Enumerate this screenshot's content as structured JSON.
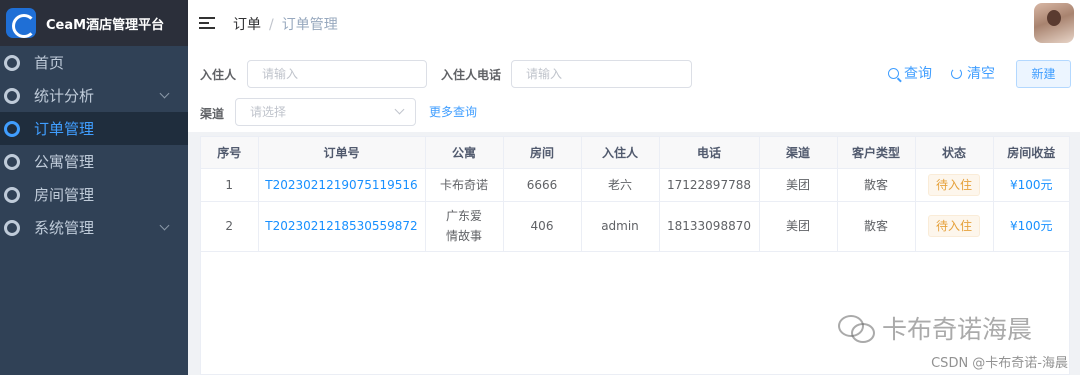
{
  "app": {
    "title": "CeaM酒店管理平台"
  },
  "sidebar": {
    "items": [
      {
        "label": "首页"
      },
      {
        "label": "统计分析"
      },
      {
        "label": "订单管理"
      },
      {
        "label": "公寓管理"
      },
      {
        "label": "房间管理"
      },
      {
        "label": "系统管理"
      }
    ],
    "active_index": 2
  },
  "header": {
    "breadcrumb": [
      "订单",
      "/",
      "订单管理"
    ]
  },
  "filters": {
    "guest_label": "入住人",
    "guest_placeholder": "请输入",
    "phone_label": "入住人电话",
    "phone_placeholder": "请输入",
    "channel_label": "渠道",
    "channel_placeholder": "请选择",
    "more_query": "更多查询",
    "query_button": "查询",
    "clear_button": "清空",
    "new_button": "新建"
  },
  "table": {
    "columns": [
      "序号",
      "订单号",
      "公寓",
      "房间",
      "入住人",
      "电话",
      "渠道",
      "客户类型",
      "状态",
      "房间收益"
    ],
    "rows": [
      {
        "index": "1",
        "order_no": "T2023021219075119516",
        "apartment": "卡布奇诺",
        "room": "6666",
        "guest": "老六",
        "phone": "17122897788",
        "channel": "美团",
        "customer_type": "散客",
        "status": "待入住",
        "income": "¥100元"
      },
      {
        "index": "2",
        "order_no": "T2023021218530559872",
        "apartment": "广东爱情故事",
        "room": "406",
        "guest": "admin",
        "phone": "18133098870",
        "channel": "美团",
        "customer_type": "散客",
        "status": "待入住",
        "income": "¥100元"
      }
    ]
  },
  "watermark": {
    "main": "卡布奇诺海晨",
    "sub": "CSDN @卡布奇诺-海晨"
  },
  "colors": {
    "sidebar_bg": "#304156",
    "accent": "#409eff",
    "status_warning": "#e6a23c"
  }
}
